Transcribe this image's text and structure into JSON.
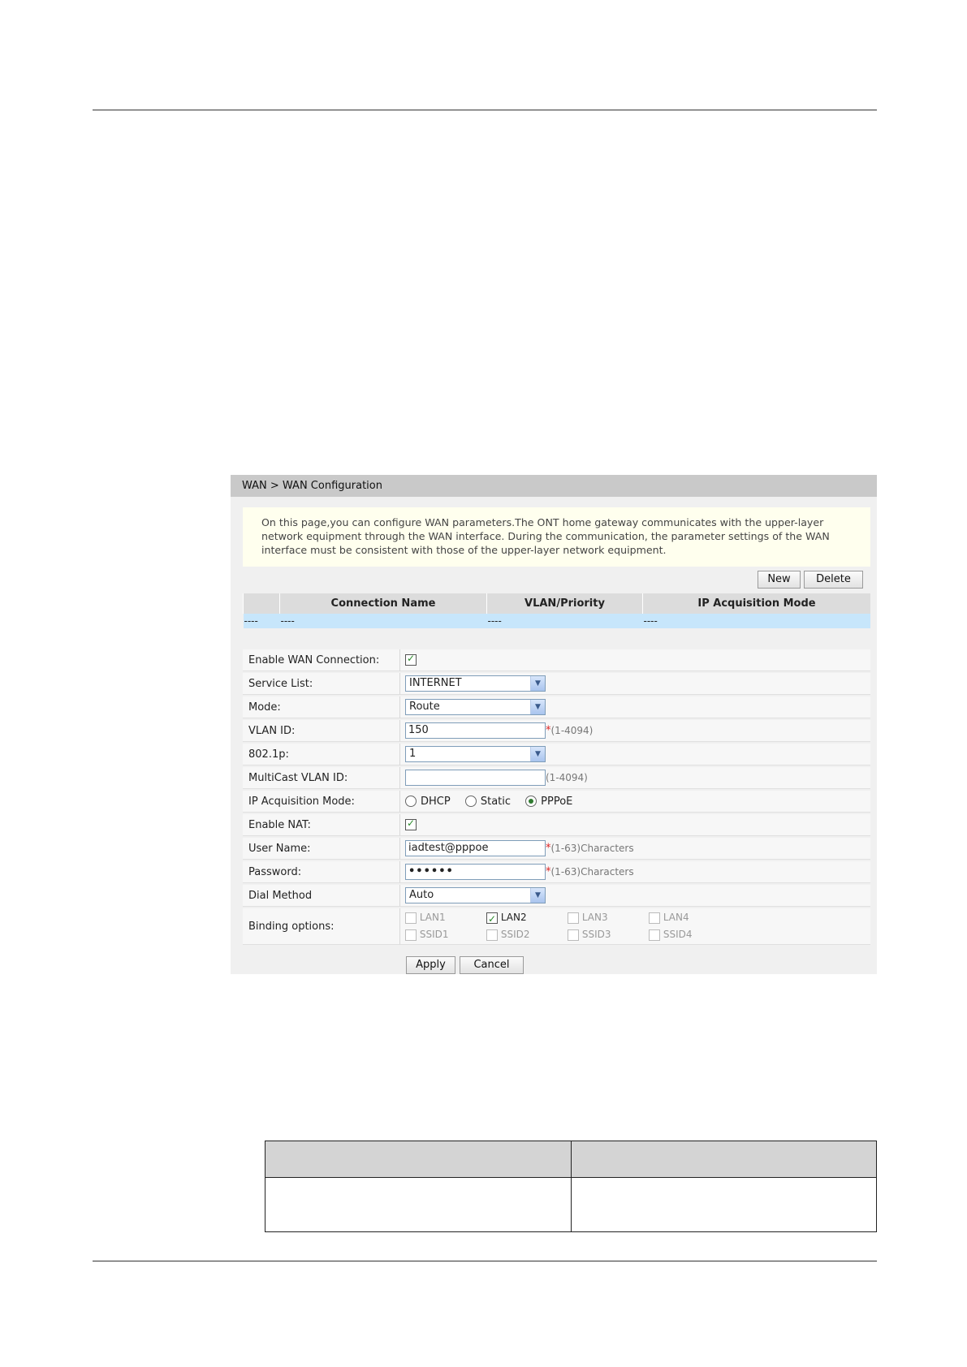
{
  "breadcrumb": "WAN > WAN Configuration",
  "notice": "On this page,you can configure WAN parameters.The ONT home gateway communicates with the upper-layer network equipment through the WAN interface. During the communication, the parameter settings of the WAN interface must be consistent with those of the upper-layer network equipment.",
  "buttons": {
    "new": "New",
    "delete": "Delete",
    "apply": "Apply",
    "cancel": "Cancel"
  },
  "list": {
    "headers": [
      "",
      "Connection Name",
      "VLAN/Priority",
      "IP Acquisition Mode"
    ],
    "row": [
      "----",
      "----",
      "----",
      "----"
    ]
  },
  "form": {
    "enable_wan": {
      "label": "Enable WAN Connection:",
      "checked": true
    },
    "service_list": {
      "label": "Service List:",
      "value": "INTERNET"
    },
    "mode": {
      "label": "Mode:",
      "value": "Route"
    },
    "vlan_id": {
      "label": "VLAN ID:",
      "value": "150",
      "hint": "(1-4094)"
    },
    "p8021": {
      "label": "802.1p:",
      "value": "1"
    },
    "multicast": {
      "label": "MultiCast VLAN ID:",
      "value": "",
      "hint": "(1-4094)"
    },
    "ip_mode": {
      "label": "IP Acquisition Mode:",
      "options": [
        "DHCP",
        "Static",
        "PPPoE"
      ],
      "selected": "PPPoE"
    },
    "enable_nat": {
      "label": "Enable NAT:",
      "checked": true
    },
    "user_name": {
      "label": "User Name:",
      "value": "iadtest@pppoe",
      "hint": "(1-63)Characters"
    },
    "password": {
      "label": "Password:",
      "value": "••••••",
      "hint": "(1-63)Characters"
    },
    "dial_method": {
      "label": "Dial Method",
      "value": "Auto"
    },
    "binding": {
      "label": "Binding options:",
      "row1": [
        "LAN1",
        "LAN2",
        "LAN3",
        "LAN4"
      ],
      "row2": [
        "SSID1",
        "SSID2",
        "SSID3",
        "SSID4"
      ],
      "checked": [
        "LAN2"
      ]
    }
  },
  "required_mark": "*"
}
